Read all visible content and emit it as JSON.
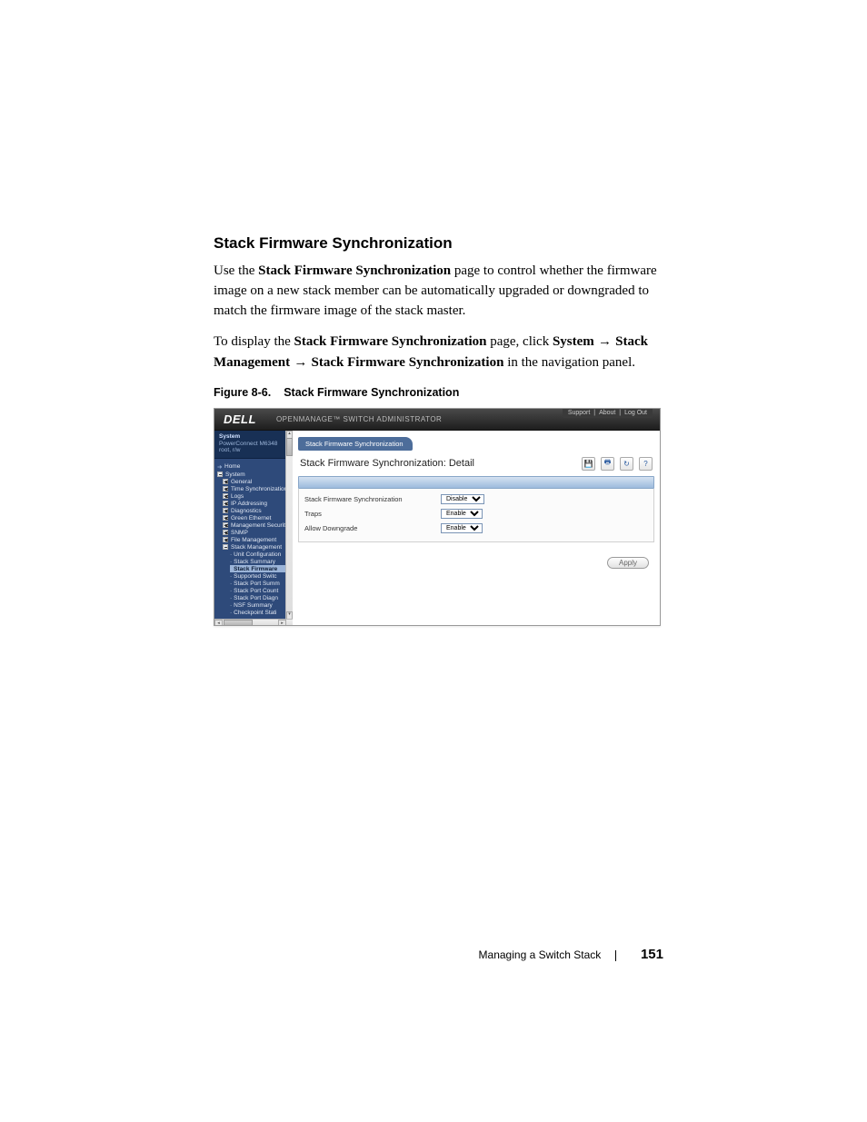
{
  "doc": {
    "heading": "Stack Firmware Synchronization",
    "para1_a": "Use the ",
    "para1_b": "Stack Firmware Synchronization",
    "para1_c": " page to control whether the firmware image on a new stack member can be automatically upgraded or downgraded to match the firmware image of the stack master.",
    "para2_a": "To display the ",
    "para2_b": "Stack Firmware Synchronization",
    "para2_c": " page, click ",
    "para2_d": "System",
    "para2_e": " → ",
    "para2_f": "Stack Management",
    "para2_g": " → ",
    "para2_h": "Stack Firmware Synchronization",
    "para2_i": " in the navigation panel.",
    "figcap_a": "Figure 8-6.",
    "figcap_b": "Stack Firmware Synchronization"
  },
  "shot": {
    "logo": "DELL",
    "app_title": "OPENMANAGE™ SWITCH ADMINISTRATOR",
    "toplinks": {
      "support": "Support",
      "about": "About",
      "logout": "Log Out"
    },
    "sidebar": {
      "title1": "System",
      "title2": "PowerConnect M6348",
      "title3": "root, r/w",
      "items": [
        {
          "lvl": 0,
          "kind": "home",
          "label": "Home"
        },
        {
          "lvl": 0,
          "kind": "minus",
          "label": "System"
        },
        {
          "lvl": 1,
          "kind": "plus",
          "label": "General"
        },
        {
          "lvl": 1,
          "kind": "plus",
          "label": "Time Synchronization"
        },
        {
          "lvl": 1,
          "kind": "plus",
          "label": "Logs"
        },
        {
          "lvl": 1,
          "kind": "plus",
          "label": "IP Addressing"
        },
        {
          "lvl": 1,
          "kind": "plus",
          "label": "Diagnostics"
        },
        {
          "lvl": 1,
          "kind": "plus",
          "label": "Green Ethernet"
        },
        {
          "lvl": 1,
          "kind": "plus",
          "label": "Management Security"
        },
        {
          "lvl": 1,
          "kind": "plus",
          "label": "SNMP"
        },
        {
          "lvl": 1,
          "kind": "plus",
          "label": "File Management"
        },
        {
          "lvl": 1,
          "kind": "minus",
          "label": "Stack Management"
        },
        {
          "lvl": 2,
          "kind": "leaf",
          "label": "Unit Configuration"
        },
        {
          "lvl": 2,
          "kind": "leaf",
          "label": "Stack Summary"
        },
        {
          "lvl": 2,
          "kind": "sel",
          "label": "Stack Firmware"
        },
        {
          "lvl": 2,
          "kind": "leaf",
          "label": "Supported Switc"
        },
        {
          "lvl": 2,
          "kind": "leaf",
          "label": "Stack Port Summ"
        },
        {
          "lvl": 2,
          "kind": "leaf",
          "label": "Stack Port Count"
        },
        {
          "lvl": 2,
          "kind": "leaf",
          "label": "Stack Port Diagn"
        },
        {
          "lvl": 2,
          "kind": "leaf",
          "label": "NSF Summary"
        },
        {
          "lvl": 2,
          "kind": "leaf",
          "label": "Checkpoint Stati"
        }
      ]
    },
    "main": {
      "crumb": "Stack Firmware Synchronization",
      "detail_title": "Stack Firmware Synchronization: Detail",
      "rows": [
        {
          "label": "Stack Firmware Synchronization",
          "value": "Disable"
        },
        {
          "label": "Traps",
          "value": "Enable"
        },
        {
          "label": "Allow Downgrade",
          "value": "Enable"
        }
      ],
      "apply": "Apply"
    }
  },
  "footer": {
    "chapter": "Managing a Switch Stack",
    "page": "151"
  }
}
